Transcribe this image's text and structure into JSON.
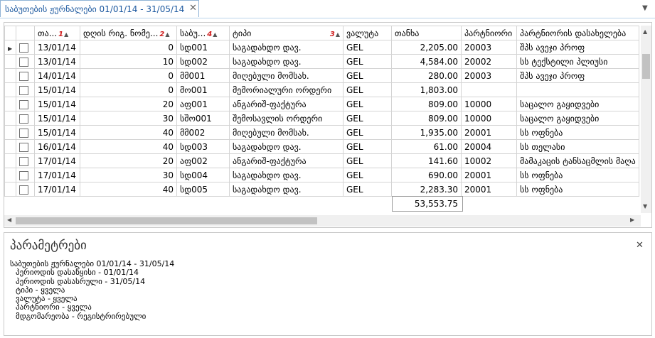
{
  "tab": {
    "title": "საბუთების ჟურნალები 01/01/14 - 31/05/14",
    "close_glyph": "✕",
    "menu_glyph": "▼"
  },
  "grid": {
    "columns": [
      {
        "label": "თა...",
        "sort_order": "1"
      },
      {
        "label": "დღის რიგ. ნომე...",
        "sort_order": "2"
      },
      {
        "label": "საბუ...",
        "sort_order": "4"
      },
      {
        "label": "ტიპი",
        "sort_order": "3"
      },
      {
        "label": "ვალუტა",
        "sort_order": ""
      },
      {
        "label": "თანხა",
        "sort_order": ""
      },
      {
        "label": "პარტნიორი",
        "sort_order": ""
      },
      {
        "label": "პარტნიორის დასახელება",
        "sort_order": ""
      }
    ],
    "sort_arrow": "▲",
    "row_indicator": "▶",
    "rows": [
      {
        "date": "13/01/14",
        "day_no": "0",
        "doc": "სდ001",
        "type": "საგადახდო დავ.",
        "currency": "GEL",
        "amount": "2,205.00",
        "partner": "20003",
        "partner_name": "შპს ავეჯი პროფ"
      },
      {
        "date": "13/01/14",
        "day_no": "10",
        "doc": "სდ002",
        "type": "საგადახდო დავ.",
        "currency": "GEL",
        "amount": "4,584.00",
        "partner": "20002",
        "partner_name": "სს ტექსტილი პლიუსი"
      },
      {
        "date": "14/01/14",
        "day_no": "0",
        "doc": "მმ001",
        "type": "მიღებული მომსახ.",
        "currency": "GEL",
        "amount": "280.00",
        "partner": "20003",
        "partner_name": "შპს ავეჯი პროფ"
      },
      {
        "date": "15/01/14",
        "day_no": "0",
        "doc": "მო001",
        "type": "მემორიალური ორდერი",
        "currency": "GEL",
        "amount": "1,803.00",
        "partner": "",
        "partner_name": ""
      },
      {
        "date": "15/01/14",
        "day_no": "20",
        "doc": "აფ001",
        "type": "ანგარიშ-ფაქტურა",
        "currency": "GEL",
        "amount": "809.00",
        "partner": "10000",
        "partner_name": "საცალო გაყიდვები"
      },
      {
        "date": "15/01/14",
        "day_no": "30",
        "doc": "სშო001",
        "type": "შემოსავლის ორდერი",
        "currency": "GEL",
        "amount": "809.00",
        "partner": "10000",
        "partner_name": "საცალო გაყიდვები"
      },
      {
        "date": "15/01/14",
        "day_no": "40",
        "doc": "მმ002",
        "type": "მიღებული მომსახ.",
        "currency": "GEL",
        "amount": "1,935.00",
        "partner": "20001",
        "partner_name": "სს ოფნება"
      },
      {
        "date": "16/01/14",
        "day_no": "40",
        "doc": "სდ003",
        "type": "საგადახდო დავ.",
        "currency": "GEL",
        "amount": "61.00",
        "partner": "20004",
        "partner_name": "სს თელასი"
      },
      {
        "date": "17/01/14",
        "day_no": "20",
        "doc": "აფ002",
        "type": "ანგარიშ-ფაქტურა",
        "currency": "GEL",
        "amount": "141.60",
        "partner": "10002",
        "partner_name": "მამაკაცის ტანსაცმლის მაღა"
      },
      {
        "date": "17/01/14",
        "day_no": "30",
        "doc": "სდ004",
        "type": "საგადახდო დავ.",
        "currency": "GEL",
        "amount": "690.00",
        "partner": "20001",
        "partner_name": "სს ოფნება"
      },
      {
        "date": "17/01/14",
        "day_no": "40",
        "doc": "სდ005",
        "type": "საგადახდო დავ.",
        "currency": "GEL",
        "amount": "2,283.30",
        "partner": "20001",
        "partner_name": "სს ოფნება"
      }
    ],
    "total": "53,553.75"
  },
  "scroll": {
    "up": "▲",
    "down": "▼",
    "left": "◀",
    "right": "▶"
  },
  "params": {
    "title": "პარამეტრები",
    "close_glyph": "✕",
    "lines": [
      "საბუთების ჟურნალები 01/01/14 - 31/05/14",
      "პერიოდის დასაწყისი  - 01/01/14",
      "პერიოდის დასასრული  - 31/05/14",
      "ტიპი  - ყველა",
      "ვალუტა  - ყველა",
      "პარტნიორი  - ყველა",
      "მდგომარეობა  - რეგისტრირებული"
    ]
  }
}
